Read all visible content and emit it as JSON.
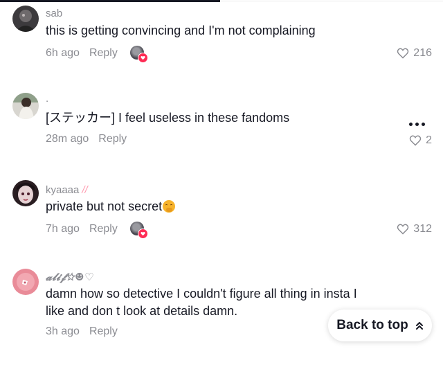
{
  "comments": [
    {
      "username": "sab",
      "text": "this is getting convincing and I'm not complaining",
      "time": "6h ago",
      "reply": "Reply",
      "likes": "216",
      "creator_liked": true
    },
    {
      "username": ".",
      "text": "[ステッカー] I feel useless in these fandoms",
      "time": "28m ago",
      "reply": "Reply",
      "likes": "2",
      "creator_liked": false
    },
    {
      "username": "kyaaaa",
      "username_suffix": "//",
      "text": "private but not secret",
      "time": "7h ago",
      "reply": "Reply",
      "likes": "312",
      "creator_liked": true
    },
    {
      "username": "𝓪𝓵𝓲𝓯☆☻♡",
      "text_line1": "damn how so detective I couldn't figure all thing in insta I",
      "text_line2": "like and don t look at details damn.",
      "time": "3h ago",
      "reply": "Reply"
    }
  ],
  "back_to_top": {
    "label": "Back to top"
  },
  "colors": {
    "text": "#161823",
    "muted": "#8a8b91",
    "accent": "#fe2c55"
  },
  "icons": {
    "like": "heart-outline-icon",
    "more": "more-dots-icon",
    "back_to_top": "chevron-double-up-icon",
    "creator_like": "creator-liked-badge-icon"
  }
}
